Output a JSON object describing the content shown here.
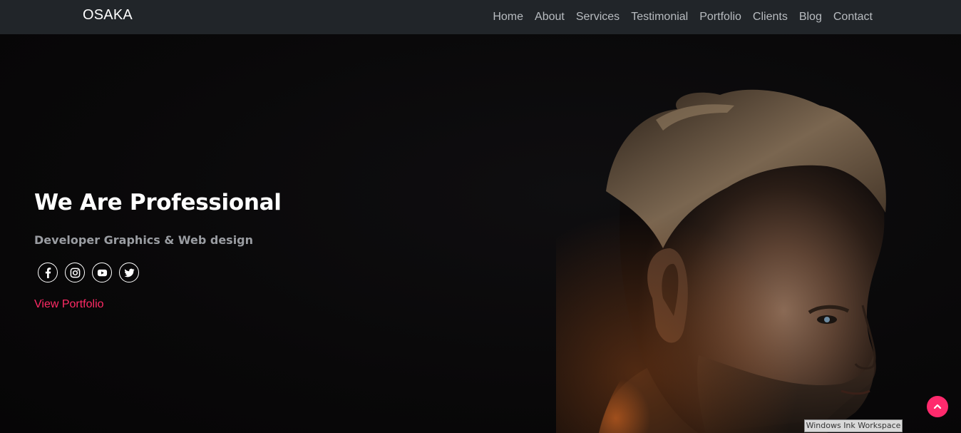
{
  "navbar": {
    "brand": "OSAKA",
    "links": [
      "Home",
      "About",
      "Services",
      "Testimonial",
      "Portfolio",
      "Clients",
      "Blog",
      "Contact"
    ]
  },
  "hero": {
    "title": "We Are Professional",
    "subtitle": "Developer Graphics & Web design",
    "socials": [
      "facebook-icon",
      "instagram-icon",
      "youtube-icon",
      "twitter-icon"
    ],
    "cta": "View Portfolio"
  },
  "overlay": {
    "ink_workspace": "Windows Ink Workspace"
  },
  "colors": {
    "navbar_bg": "#212529",
    "accent": "#ff2a6d",
    "hero_bg": "#0b0a0b"
  }
}
